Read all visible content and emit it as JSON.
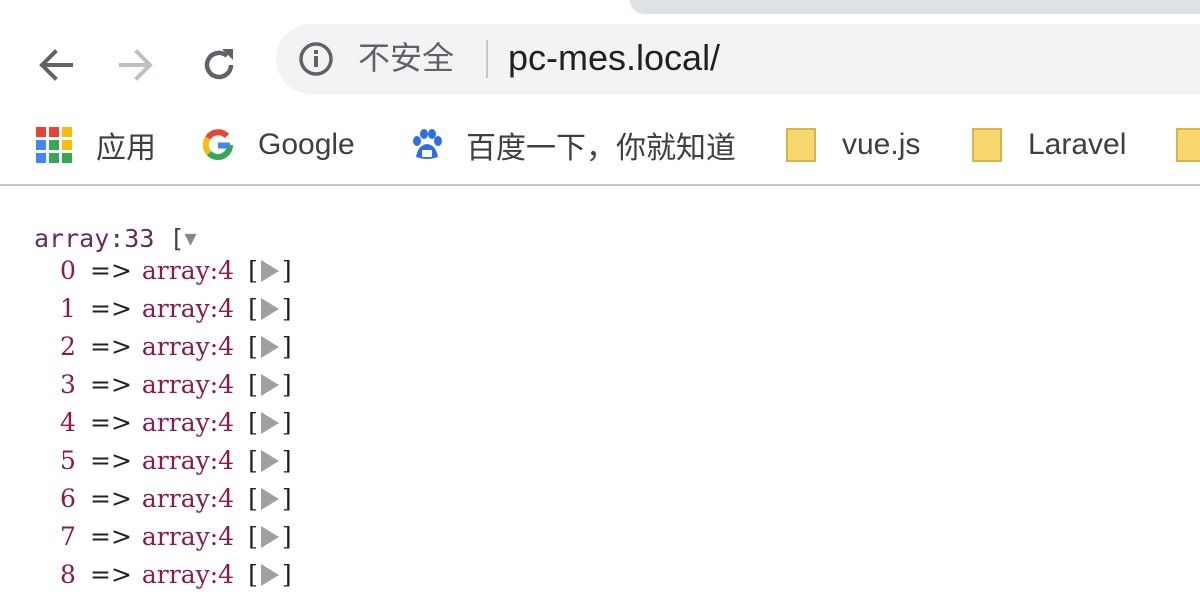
{
  "browser": {
    "security_label": "不安全",
    "url": "pc-mes.local/"
  },
  "bookmarks": [
    {
      "label": "应用",
      "icon": "apps-grid-icon"
    },
    {
      "label": "Google",
      "icon": "google-icon"
    },
    {
      "label": "百度一下，你就知道",
      "icon": "baidu-paw-icon"
    },
    {
      "label": "vue.js",
      "icon": "folder-icon"
    },
    {
      "label": "Laravel",
      "icon": "folder-icon"
    }
  ],
  "dump": {
    "header": "array:33",
    "open_bracket": "[",
    "rows": [
      {
        "index": "0",
        "arrow": "=>",
        "type": "array:4"
      },
      {
        "index": "1",
        "arrow": "=>",
        "type": "array:4"
      },
      {
        "index": "2",
        "arrow": "=>",
        "type": "array:4"
      },
      {
        "index": "3",
        "arrow": "=>",
        "type": "array:4"
      },
      {
        "index": "4",
        "arrow": "=>",
        "type": "array:4"
      },
      {
        "index": "5",
        "arrow": "=>",
        "type": "array:4"
      },
      {
        "index": "6",
        "arrow": "=>",
        "type": "array:4"
      },
      {
        "index": "7",
        "arrow": "=>",
        "type": "array:4"
      },
      {
        "index": "8",
        "arrow": "=>",
        "type": "array:4"
      }
    ]
  },
  "colors": {
    "dump_key": "#8b1a50",
    "omnibox_bg": "#f1f3f4",
    "folder_yellow": "#f5d76e"
  }
}
